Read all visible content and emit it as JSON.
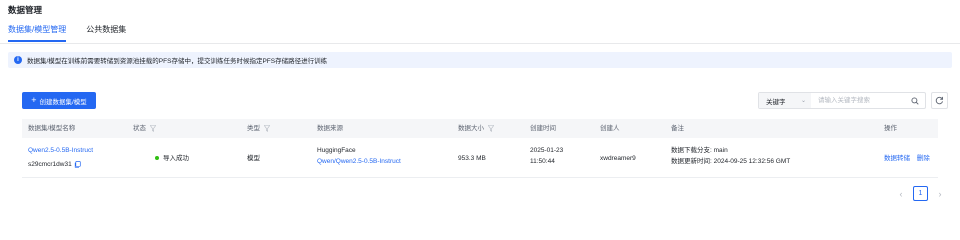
{
  "page": {
    "title": "数据管理"
  },
  "tabs": [
    {
      "label": "数据集/模型管理",
      "active": true
    },
    {
      "label": "公共数据集",
      "active": false
    }
  ],
  "notice": {
    "text": "数据集/模型在训练前需要转储到资源池挂载的PFS存储中，提交训练任务时候指定PFS存储路径进行训练"
  },
  "toolbar": {
    "create_label": "创建数据集/模型",
    "search_field": "关键字",
    "search_placeholder": "请输入关键字搜索"
  },
  "table": {
    "columns": [
      "数据集/模型名称",
      "状态",
      "类型",
      "数据来源",
      "数据大小",
      "创建时间",
      "创建人",
      "备注",
      "操作"
    ],
    "rows": [
      {
        "name": "Qwen2.5-0.5B-Instruct",
        "id": "s29cmcr1dw31",
        "status": "导入成功",
        "type": "模型",
        "source_title": "HuggingFace",
        "source_link": "Qwen/Qwen2.5-0.5B-Instruct",
        "size": "953.3 MB",
        "created_date": "2025-01-23",
        "created_time": "11:50:44",
        "creator": "xwdreamer9",
        "note_line1": "数据下载分支: main",
        "note_line2": "数据更新时间: 2024-09-25 12:32:56 GMT",
        "action_transfer": "数据转储",
        "action_delete": "删除"
      }
    ]
  },
  "pagination": {
    "current": "1"
  },
  "colors": {
    "accent": "#2468f2",
    "success": "#30bf13",
    "notice_bg": "#eef3fe"
  }
}
